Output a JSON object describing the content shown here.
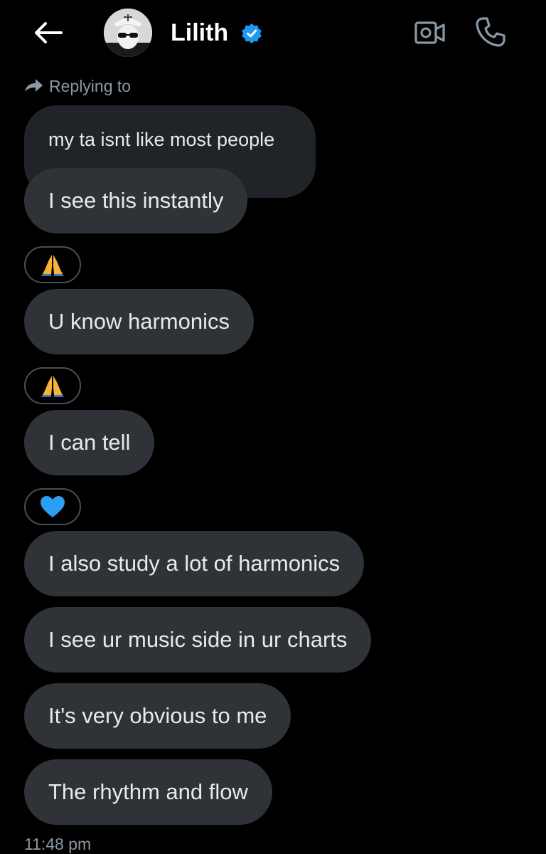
{
  "header": {
    "contact_name": "Lilith",
    "verified": true,
    "icons": {
      "back": "arrow-left-icon",
      "video": "video-camera-icon",
      "call": "phone-icon",
      "verified": "verified-badge-icon"
    }
  },
  "reply": {
    "label": "Replying to",
    "icon": "reply-arrow-icon"
  },
  "messages": {
    "quoted": "my ta isnt like most people",
    "m1": "I see this instantly",
    "m2": "U know harmonics",
    "m3": "I can tell",
    "m4": "I also study a lot of harmonics",
    "m5": "I see ur music side in ur charts",
    "m6": "It's very obvious to me",
    "m7": "The rhythm and flow"
  },
  "reactions": {
    "r1": "folded-hands-emoji",
    "r2": "folded-hands-emoji",
    "r3": "blue-heart-emoji"
  },
  "timestamp": "11:48 pm",
  "colors": {
    "background": "#000000",
    "bubble": "#2f3337",
    "quoted_bubble": "#202327",
    "secondary_text": "#8b98a5",
    "verified_blue": "#1d9bf0",
    "heart_blue": "#2b9ef5"
  }
}
